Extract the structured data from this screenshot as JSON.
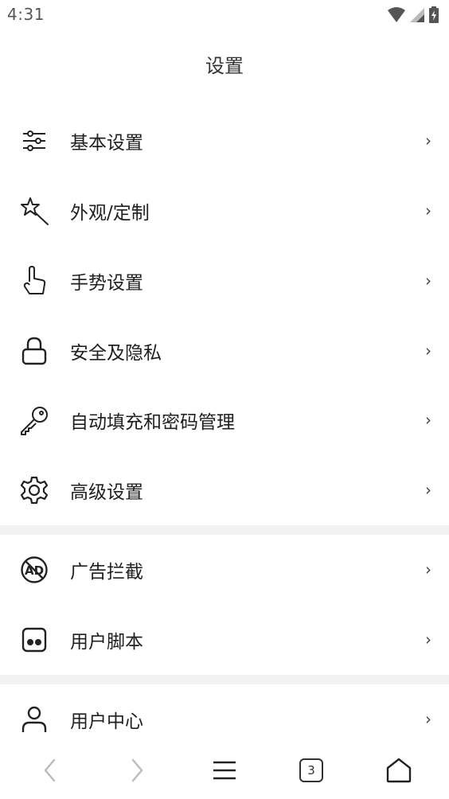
{
  "status": {
    "time": "4:31"
  },
  "header": {
    "title": "设置"
  },
  "items": [
    {
      "label": "基本设置",
      "icon": "sliders-icon",
      "chevron": "›"
    },
    {
      "label": "外观/定制",
      "icon": "magic-wand-icon",
      "chevron": "›"
    },
    {
      "label": "手势设置",
      "icon": "hand-pointer-icon",
      "chevron": "›"
    },
    {
      "label": "安全及隐私",
      "icon": "lock-icon",
      "chevron": "›"
    },
    {
      "label": "自动填充和密码管理",
      "icon": "key-icon",
      "chevron": "›"
    },
    {
      "label": "高级设置",
      "icon": "gear-icon",
      "chevron": "›"
    },
    {
      "label": "广告拦截",
      "icon": "ad-block-icon",
      "chevron": "›"
    },
    {
      "label": "用户脚本",
      "icon": "user-script-icon",
      "chevron": "›"
    },
    {
      "label": "用户中心",
      "icon": "user-icon",
      "chevron": "›"
    }
  ],
  "bottom_nav": {
    "tab_count": "3"
  }
}
